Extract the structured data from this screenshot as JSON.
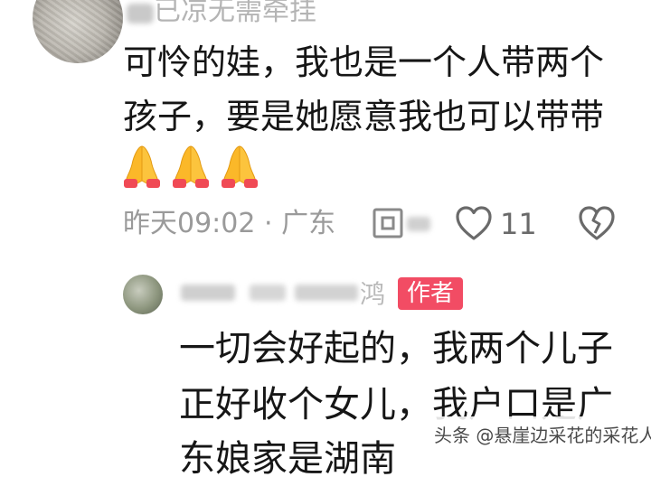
{
  "comment": {
    "username": "已凉无需牵挂",
    "lines": [
      "可怜的娃，我也是一个人带两个",
      "孩子，要是她愿意我也可以带带"
    ],
    "emojis": [
      "folded-hands",
      "folded-hands",
      "folded-hands"
    ],
    "meta": "昨天09:02 · 广东",
    "reply_label": "回",
    "like_count": "11"
  },
  "reply": {
    "username": "鸿",
    "badge": "作者",
    "lines": [
      "一切会好起的，我两个儿子",
      "正好收个女儿，我户口是广",
      "东娘家是湖南"
    ]
  },
  "watermark": "头条 @悬崖边采花的采花人"
}
